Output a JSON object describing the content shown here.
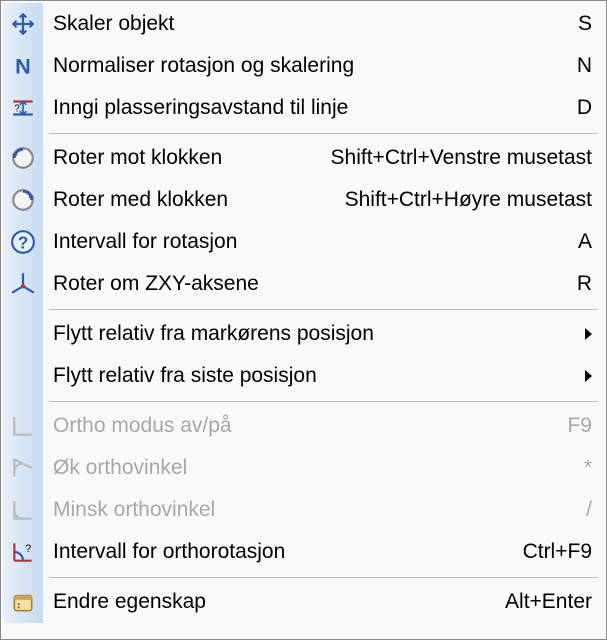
{
  "menu": {
    "items": [
      {
        "label": "Skaler objekt",
        "shortcut": "S",
        "icon": "move-icon",
        "disabled": false
      },
      {
        "label": "Normaliser rotasjon og skalering",
        "shortcut": "N",
        "icon": "n-icon",
        "disabled": false
      },
      {
        "label": "Inngi plasseringsavstand til linje",
        "shortcut": "D",
        "icon": "distance-icon",
        "disabled": false
      },
      {
        "separator": true
      },
      {
        "label": "Roter mot klokken",
        "shortcut": "Shift+Ctrl+Venstre musetast",
        "icon": "ccw-icon",
        "disabled": false
      },
      {
        "label": "Roter med klokken",
        "shortcut": "Shift+Ctrl+Høyre musetast",
        "icon": "cw-icon",
        "disabled": false
      },
      {
        "label": "Intervall for rotasjon",
        "shortcut": "A",
        "icon": "question-icon",
        "disabled": false
      },
      {
        "label": "Roter om ZXY-aksene",
        "shortcut": "R",
        "icon": "axes-icon",
        "disabled": false
      },
      {
        "separator": true
      },
      {
        "label": "Flytt relativ fra markørens posisjon",
        "submenu": true,
        "icon": "",
        "disabled": false
      },
      {
        "label": "Flytt relativ fra siste posisjon",
        "submenu": true,
        "icon": "",
        "disabled": false
      },
      {
        "separator": true
      },
      {
        "label": "Ortho modus av/på",
        "shortcut": "F9",
        "icon": "ortho-icon",
        "disabled": true
      },
      {
        "label": "Øk orthovinkel",
        "shortcut": "*",
        "icon": "angle-up-icon",
        "disabled": true
      },
      {
        "label": "Minsk orthovinkel",
        "shortcut": "/",
        "icon": "angle-down-icon",
        "disabled": true
      },
      {
        "label": "Intervall for orthorotasjon",
        "shortcut": "Ctrl+F9",
        "icon": "ortho-interval-icon",
        "disabled": false
      },
      {
        "separator": true
      },
      {
        "label": "Endre egenskap",
        "shortcut": "Alt+Enter",
        "icon": "properties-icon",
        "disabled": false
      }
    ]
  }
}
